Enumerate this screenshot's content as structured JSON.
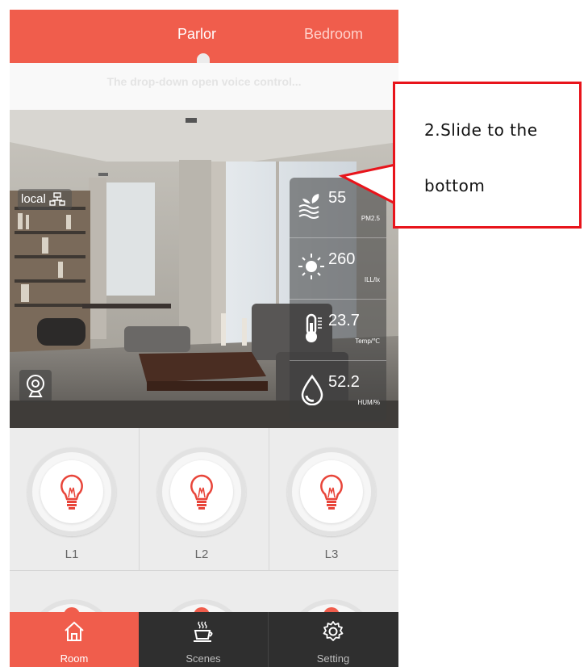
{
  "top_tabs": [
    {
      "label": "Parlor",
      "active": true
    },
    {
      "label": "Bedroom",
      "active": false
    }
  ],
  "voice_hint": "The drop-down open voice control...",
  "room": {
    "connection_label": "local",
    "connection_icon": "network-icon",
    "camera_icon": "camera-icon",
    "sensors": [
      {
        "name": "pm25",
        "value": "55",
        "unit": "PM2.5",
        "icon": "air-quality-icon"
      },
      {
        "name": "illuminance",
        "value": "260",
        "unit": "ILL/lx",
        "icon": "sun-icon"
      },
      {
        "name": "temperature",
        "value": "23.7",
        "unit": "Temp/℃",
        "icon": "thermometer-icon"
      },
      {
        "name": "humidity",
        "value": "52.2",
        "unit": "HUM/%",
        "icon": "humidity-drop-icon"
      }
    ]
  },
  "lights": [
    {
      "label": "L1",
      "icon": "bulb-icon"
    },
    {
      "label": "L2",
      "icon": "bulb-icon"
    },
    {
      "label": "L3",
      "icon": "bulb-icon"
    }
  ],
  "bottom_nav": [
    {
      "label": "Room",
      "icon": "home-icon",
      "active": true
    },
    {
      "label": "Scenes",
      "icon": "coffee-cup-icon",
      "active": false
    },
    {
      "label": "Setting",
      "icon": "gear-icon",
      "active": false
    }
  ],
  "callout": {
    "line1": "2.Slide to the",
    "line2": "bottom"
  },
  "colors": {
    "accent": "#f05d4c",
    "nav_dark": "#2f2f2f",
    "callout_border": "#e8141b",
    "bulb_red": "#e8453a"
  }
}
